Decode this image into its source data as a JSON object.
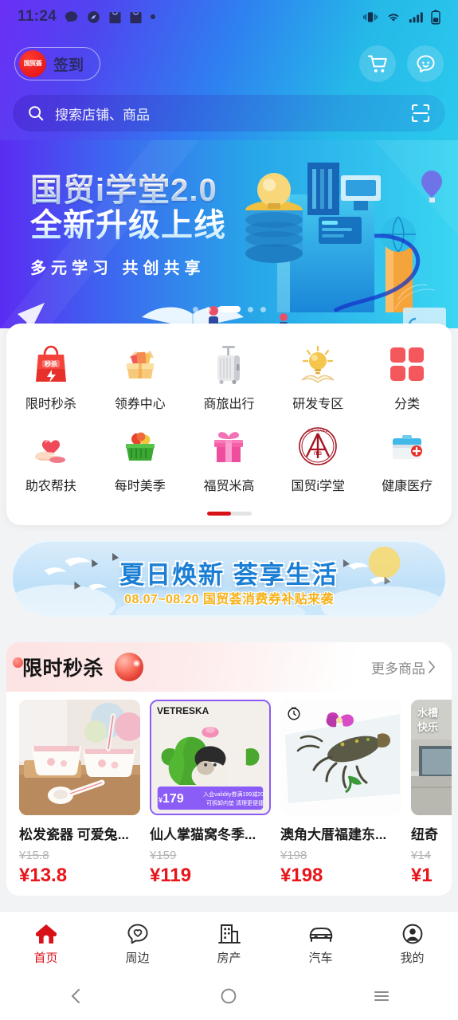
{
  "status_bar": {
    "time": "11:24",
    "left_icons": [
      "message-icon",
      "compass-icon",
      "shopping-bag-icon",
      "shopping-bag-icon",
      "dot-icon"
    ],
    "right_icons": [
      "vibrate-icon",
      "wifi-icon",
      "signal-icon",
      "battery-icon"
    ]
  },
  "header": {
    "signin_logo_text": "国贸荟",
    "signin_label": "签到",
    "cart_icon": "shopping-cart-icon",
    "chat_icon": "chat-bubble-icon"
  },
  "search": {
    "placeholder": "搜索店铺、商品",
    "search_icon": "search-icon",
    "scan_icon": "scan-code-icon"
  },
  "banner": {
    "line1": "国贸i学堂2.0",
    "line2": "全新升级上线",
    "line3": "多元学习  共创共享",
    "dot_count": 5,
    "active_dot": 3
  },
  "icon_grid": {
    "rows": [
      [
        {
          "label": "限时秒杀",
          "icon": "flash-sale-bag-icon"
        },
        {
          "label": "领券中心",
          "icon": "coupon-box-icon"
        },
        {
          "label": "商旅出行",
          "icon": "suitcase-icon"
        },
        {
          "label": "研发专区",
          "icon": "lightbulb-book-icon"
        },
        {
          "label": "分类",
          "icon": "category-grid-icon"
        }
      ],
      [
        {
          "label": "助农帮扶",
          "icon": "heart-hand-icon"
        },
        {
          "label": "每时美季",
          "icon": "fruit-basket-icon"
        },
        {
          "label": "福贸米高",
          "icon": "gift-box-icon"
        },
        {
          "label": "国贸i学堂",
          "icon": "itg-seal-icon"
        },
        {
          "label": "健康医疗",
          "icon": "medical-kit-icon"
        }
      ]
    ]
  },
  "promo_banner": {
    "title": "夏日焕新  荟享生活",
    "subtitle": "08.07~08.20 国贸荟消费券补贴来袭"
  },
  "flash_sale": {
    "title": "限时秒杀",
    "more_label": "更多商品",
    "more_icon": "chevron-right-icon",
    "badge_decoration": "red-sphere-icon",
    "products": [
      {
        "name": "松发瓷器 可爱兔...",
        "old_price": "¥15.8",
        "new_price": "¥13.8",
        "image": "pink-rabbit-ceramic-bowls"
      },
      {
        "name": "仙人掌猫窝冬季...",
        "old_price": "¥159",
        "new_price": "¥119",
        "image": "vetreska-cactus-cat-bed",
        "brand_tag": "VETRESKA",
        "badge_price": "179",
        "badge_note_1": "入会validity券满199减20",
        "badge_note_2": "可拆卸内垫 清理更便捷"
      },
      {
        "name": "澳角大厝福建东...",
        "old_price": "¥198",
        "new_price": "¥198",
        "image": "fresh-lobster-on-ice",
        "corner_icon": "timer-icon"
      },
      {
        "name": "纽奇",
        "old_price": "¥14",
        "new_price": "¥1",
        "image": "building-exterior",
        "overlay_text_1": "水槽",
        "overlay_text_2": "快乐"
      }
    ]
  },
  "tab_bar": {
    "items": [
      {
        "label": "首页",
        "icon": "home-icon",
        "active": true
      },
      {
        "label": "周边",
        "icon": "heart-chat-icon",
        "active": false
      },
      {
        "label": "房产",
        "icon": "building-icon",
        "active": false
      },
      {
        "label": "汽车",
        "icon": "car-icon",
        "active": false
      },
      {
        "label": "我的",
        "icon": "user-circle-icon",
        "active": false
      }
    ]
  },
  "system_nav": {
    "back_icon": "back-chevron-icon",
    "home_icon": "home-circle-icon",
    "recents_icon": "recents-menu-icon"
  },
  "colors": {
    "brand_red": "#d9121a",
    "price_red": "#e8161b",
    "gradient_start": "#6a2ff5",
    "gradient_end": "#2fd2ef"
  }
}
